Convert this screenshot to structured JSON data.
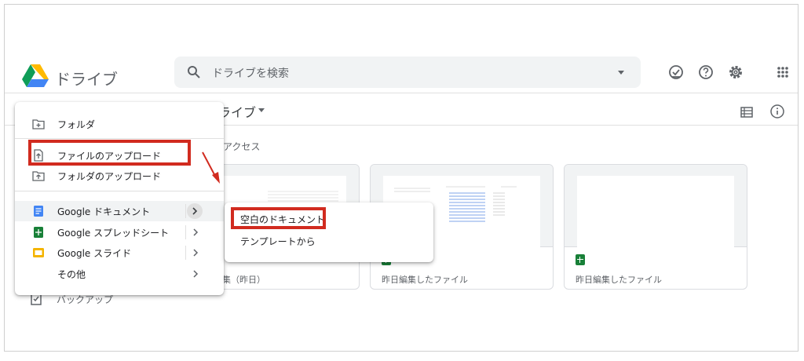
{
  "header": {
    "app_title": "ドライブ",
    "search_placeholder": "ドライブを検索",
    "icons": [
      "checkmark-circle-icon",
      "help-icon",
      "settings-icon",
      "apps-grid-icon"
    ]
  },
  "toolbar": {
    "breadcrumb": "ライブ",
    "icons": [
      "list-view-icon",
      "info-icon"
    ]
  },
  "quick_access_label": "アクセス",
  "cards": [
    {
      "meta": "さんが編集（昨日）"
    },
    {
      "meta": "昨日編集したファイル"
    },
    {
      "meta": "昨日編集したファイル"
    }
  ],
  "sidebar_below": {
    "backup_label": "バックアップ"
  },
  "new_menu": {
    "items": [
      {
        "label": "フォルダ",
        "icon": "folder-plus-icon"
      },
      {
        "label": "ファイルのアップロード",
        "icon": "file-upload-icon"
      },
      {
        "label": "フォルダのアップロード",
        "icon": "folder-upload-icon"
      },
      {
        "label": "Google ドキュメント",
        "icon": "google-docs-icon"
      },
      {
        "label": "Google スプレッドシート",
        "icon": "google-sheets-icon"
      },
      {
        "label": "Google スライド",
        "icon": "google-slides-icon"
      },
      {
        "label": "その他",
        "icon": ""
      }
    ]
  },
  "submenu": {
    "items": [
      {
        "label": "空白のドキュメント"
      },
      {
        "label": "テンプレートから"
      }
    ]
  },
  "colors": {
    "highlight": "#d12b1f",
    "docs_blue": "#4285f4",
    "sheets_green": "#188038",
    "slides_yellow": "#f4b400"
  }
}
